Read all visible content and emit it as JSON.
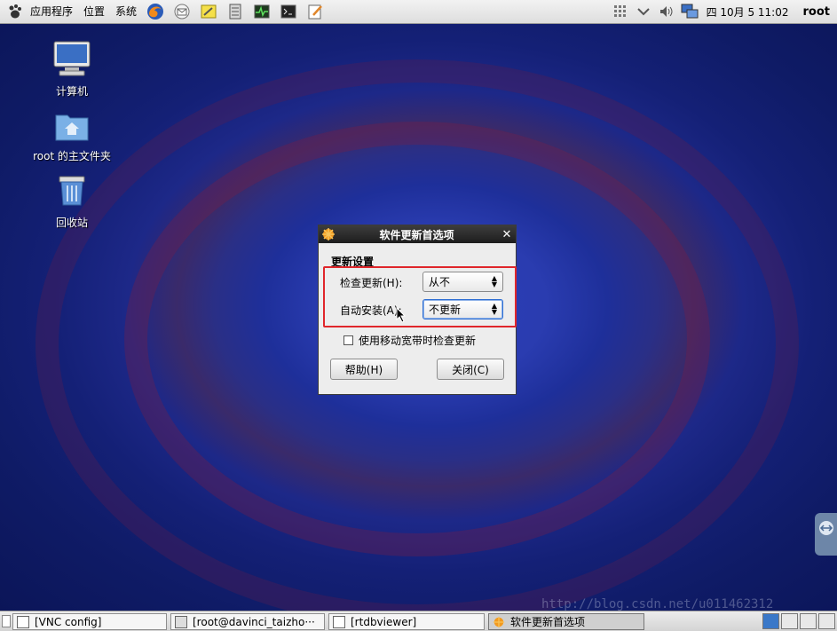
{
  "top_panel": {
    "menus": [
      "应用程序",
      "位置",
      "系统"
    ],
    "launchers": [
      "firefox-icon",
      "mail-icon",
      "notes-icon",
      "server-icon",
      "system-monitor-icon",
      "terminal-icon",
      "text-editor-icon"
    ],
    "clock": "四 10月  5 11:02",
    "user": "root"
  },
  "desktop": {
    "icons": [
      {
        "label": "计算机",
        "icon": "computer-icon"
      },
      {
        "label": "root 的主文件夹",
        "icon": "home-folder-icon"
      },
      {
        "label": "回收站",
        "icon": "trash-icon"
      }
    ]
  },
  "dialog": {
    "title": "软件更新首选项",
    "section_title": "更新设置",
    "check_updates_label": "检查更新(H):",
    "check_updates_value": "从不",
    "auto_install_label": "自动安装(A):",
    "auto_install_value": "不更新",
    "mobile_broadband_label": "使用移动宽带时检查更新",
    "mobile_broadband_checked": false,
    "help_button": "帮助(H)",
    "close_button": "关闭(C)"
  },
  "taskbar": {
    "tasks": [
      {
        "label": "[VNC config]"
      },
      {
        "label": "[root@davinci_taizho···"
      },
      {
        "label": "[rtdbviewer]"
      },
      {
        "label": "软件更新首选项"
      }
    ]
  },
  "watermark": "http://blog.csdn.net/u011462312",
  "colors": {
    "highlight": "#e0262b",
    "titlebar": "#2a2a2a",
    "desktop_bg": "#1e2f9a"
  }
}
